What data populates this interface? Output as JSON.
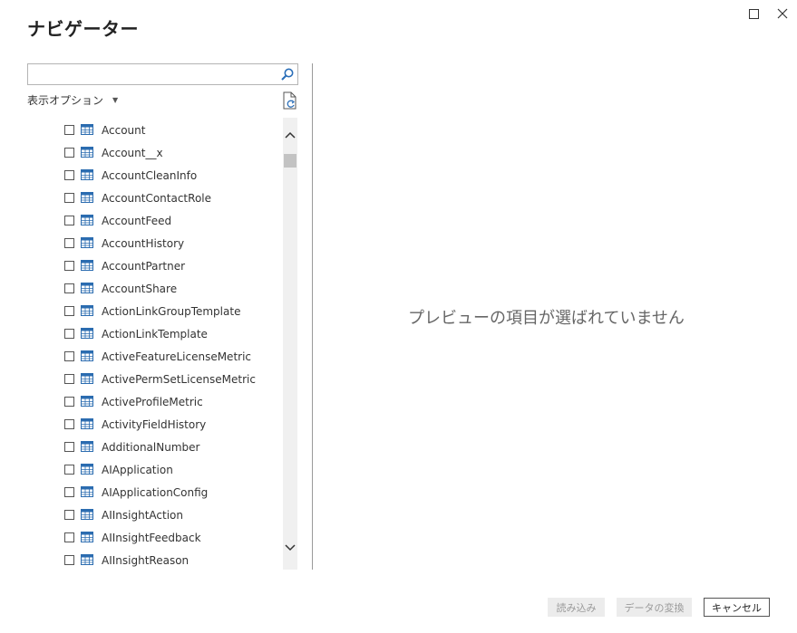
{
  "window": {
    "title": "ナビゲーター",
    "maximize_icon": "maximize-icon",
    "close_icon": "close-icon"
  },
  "search": {
    "value": "",
    "placeholder": "",
    "icon": "search-icon"
  },
  "display_options": {
    "label": "表示オプション",
    "icon": "caret-down-icon"
  },
  "refresh_icon": "refresh-document-icon",
  "tree": {
    "items": [
      "Account",
      "Account__x",
      "AccountCleanInfo",
      "AccountContactRole",
      "AccountFeed",
      "AccountHistory",
      "AccountPartner",
      "AccountShare",
      "ActionLinkGroupTemplate",
      "ActionLinkTemplate",
      "ActiveFeatureLicenseMetric",
      "ActivePermSetLicenseMetric",
      "ActiveProfileMetric",
      "ActivityFieldHistory",
      "AdditionalNumber",
      "AIApplication",
      "AIApplicationConfig",
      "AIInsightAction",
      "AIInsightFeedback",
      "AIInsightReason"
    ]
  },
  "preview": {
    "empty_message": "プレビューの項目が選ばれていません"
  },
  "footer": {
    "load_label": "読み込み",
    "transform_label": "データの変換",
    "cancel_label": "キャンセル"
  },
  "colors": {
    "table_icon": "#2b6cb0",
    "search_icon": "#2a6eb8"
  }
}
